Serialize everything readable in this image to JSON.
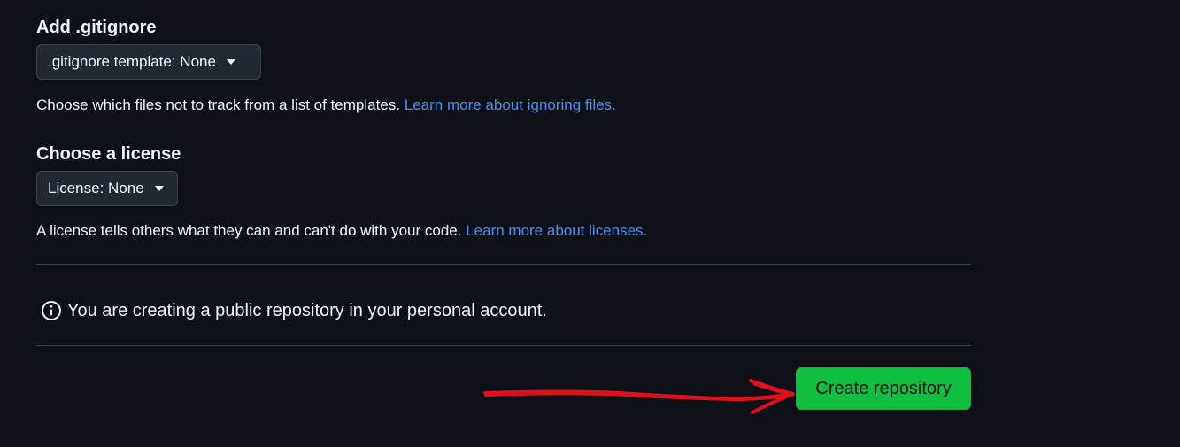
{
  "gitignore": {
    "heading": "Add .gitignore",
    "dropdown_label": ".gitignore template: None",
    "help_text": "Choose which files not to track from a list of templates.",
    "help_link": "Learn more about ignoring files."
  },
  "license": {
    "heading": "Choose a license",
    "dropdown_label": "License: None",
    "help_text": "A license tells others what they can and can't do with your code.",
    "help_link": "Learn more about licenses."
  },
  "notice": {
    "text": "You are creating a public repository in your personal account.",
    "icon": "info-icon"
  },
  "actions": {
    "create_label": "Create repository"
  },
  "annotation": {
    "icon": "red-arrow",
    "color": "#e0101a"
  },
  "colors": {
    "background": "#0d1117",
    "link": "#4493f8",
    "primary_button": "#0fbf3e"
  }
}
